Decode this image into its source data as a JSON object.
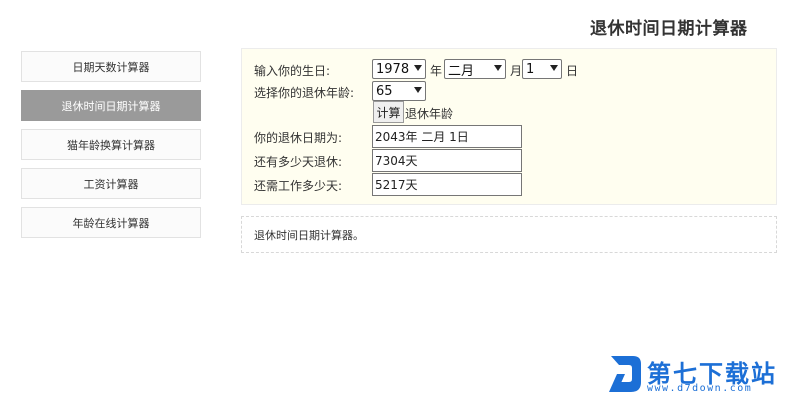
{
  "page_title": "退休时间日期计算器",
  "sidebar": {
    "items": [
      {
        "label": "日期天数计算器",
        "active": false
      },
      {
        "label": "退休时间日期计算器",
        "active": true
      },
      {
        "label": "猫年龄换算计算器",
        "active": false
      },
      {
        "label": "工资计算器",
        "active": false
      },
      {
        "label": "年龄在线计算器",
        "active": false
      }
    ]
  },
  "form": {
    "birthday_label": "输入你的生日:",
    "year_value": "1978",
    "year_unit": "年",
    "month_value": "二月",
    "month_unit": "月",
    "day_value": "1",
    "day_unit": "日",
    "retire_age_label": "选择你的退休年龄:",
    "retire_age_value": "65",
    "calc_button": "计算",
    "calc_button_suffix": "退休年龄",
    "retire_date_label": "你的退休日期为:",
    "retire_date_value": "2043年 二月 1日",
    "days_left_label": "还有多少天退休:",
    "days_left_value": "7304天",
    "work_days_label": "还需工作多少天:",
    "work_days_value": "5217天"
  },
  "description": "退休时间日期计算器。",
  "watermark": {
    "brand": "第七下载站",
    "url": "www.d7down.com",
    "color": "#1c6fd6"
  }
}
